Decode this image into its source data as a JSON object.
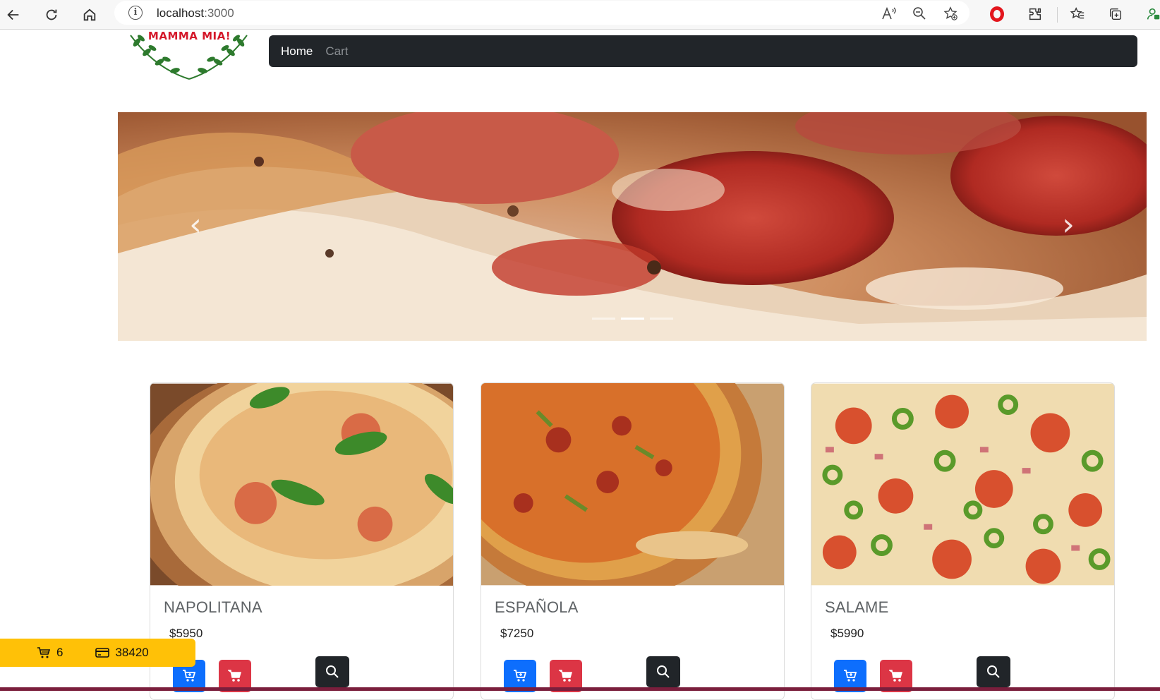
{
  "browser": {
    "url_host": "localhost",
    "url_port": ":3000"
  },
  "brand": {
    "logo_text": "MAMMA MIA!"
  },
  "navbar": {
    "links": [
      {
        "label": "Home",
        "active": true
      },
      {
        "label": "Cart",
        "active": false
      }
    ]
  },
  "carousel": {
    "slide_count": 3,
    "active_index": 1,
    "prev_label": "‹",
    "next_label": "›"
  },
  "products": [
    {
      "name": "NAPOLITANA",
      "price": "$5950"
    },
    {
      "name": "ESPAÑOLA",
      "price": "$7250"
    },
    {
      "name": "SALAME",
      "price": "$5990"
    }
  ],
  "summary": {
    "cart_count": "6",
    "total": "38420"
  },
  "colors": {
    "navbar_bg": "#212529",
    "primary": "#0d6efd",
    "danger": "#dc3545",
    "warning": "#ffc107",
    "dark": "#212529"
  }
}
